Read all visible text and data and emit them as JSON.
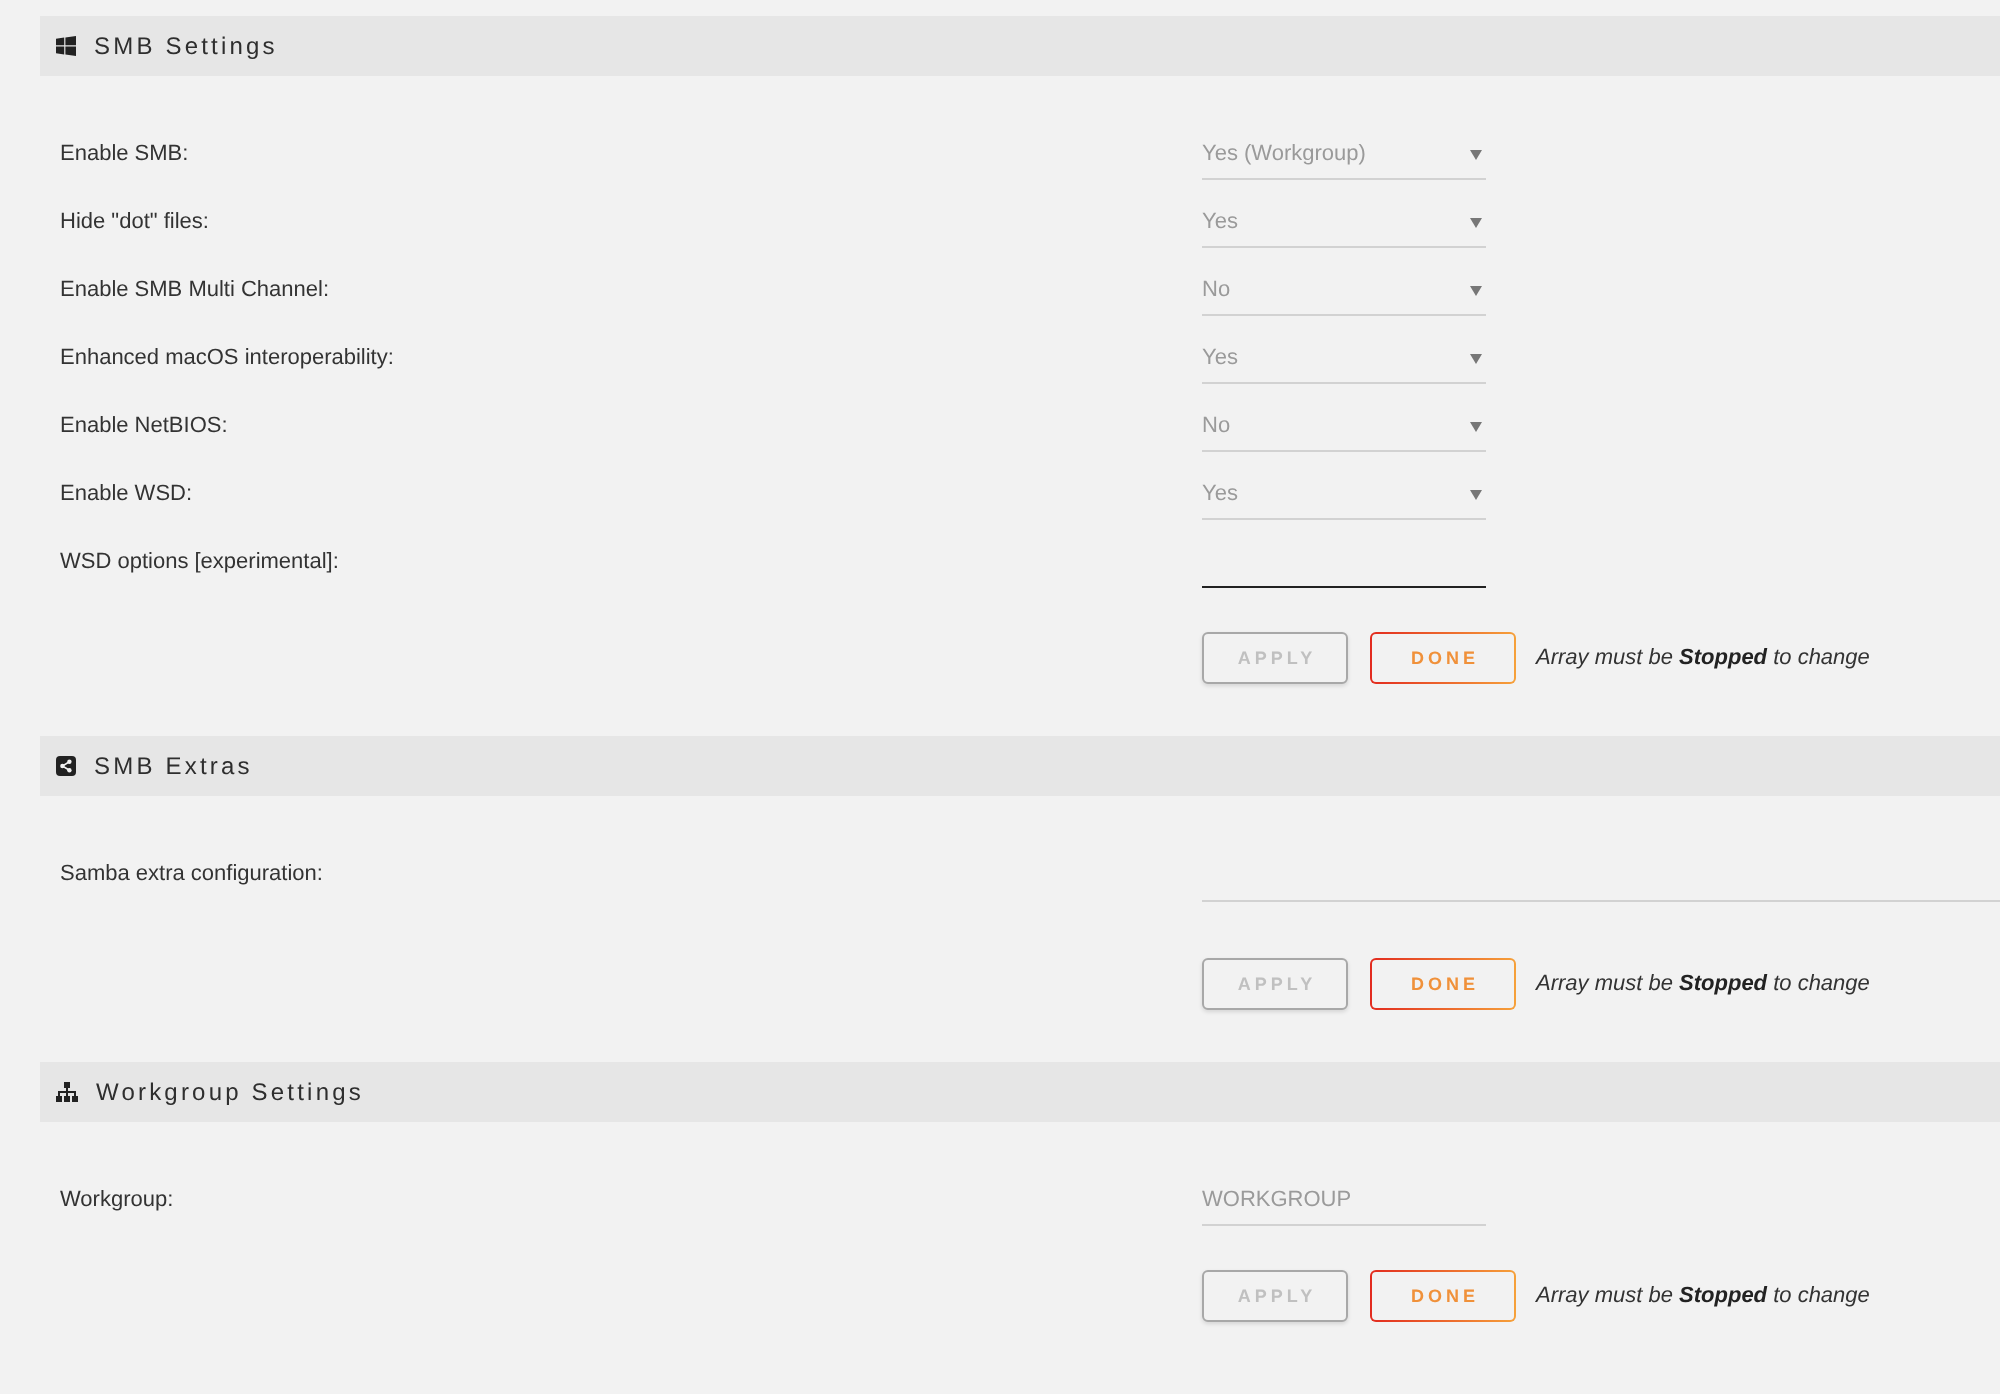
{
  "sections": [
    {
      "title": "SMB Settings",
      "fields": [
        {
          "label": "Enable SMB:",
          "kind": "select",
          "value": "Yes (Workgroup)",
          "disabled": true
        },
        {
          "label": "Hide \"dot\" files:",
          "kind": "select",
          "value": "Yes",
          "disabled": true
        },
        {
          "label": "Enable SMB Multi Channel:",
          "kind": "select",
          "value": "No",
          "disabled": true
        },
        {
          "label": "Enhanced macOS interoperability:",
          "kind": "select",
          "value": "Yes",
          "disabled": true
        },
        {
          "label": "Enable NetBIOS:",
          "kind": "select",
          "value": "No",
          "disabled": true
        },
        {
          "label": "Enable WSD:",
          "kind": "select",
          "value": "Yes",
          "disabled": true
        },
        {
          "label": "WSD options [experimental]:",
          "kind": "text",
          "disabled": false
        }
      ],
      "buttons": [
        {
          "label": "APPLY",
          "disabled": true
        },
        {
          "label": "DONE",
          "disabled": false
        }
      ],
      "note": "Array must be **Stopped** to change"
    },
    {
      "title": "SMB Extras",
      "fields": [
        {
          "label": "Samba extra configuration:",
          "kind": "textarea",
          "disabled": true
        }
      ],
      "buttons": [
        {
          "label": "APPLY",
          "disabled": true
        },
        {
          "label": "DONE",
          "disabled": false
        }
      ],
      "note": "Array must be **Stopped** to change"
    },
    {
      "title": "Workgroup Settings",
      "fields": [
        {
          "label": "Workgroup:",
          "kind": "text",
          "value": "WORKGROUP",
          "disabled": true
        }
      ],
      "buttons": [
        {
          "label": "APPLY",
          "disabled": true
        },
        {
          "label": "DONE",
          "disabled": false
        }
      ],
      "note": "Array must be **Stopped** to change"
    }
  ]
}
